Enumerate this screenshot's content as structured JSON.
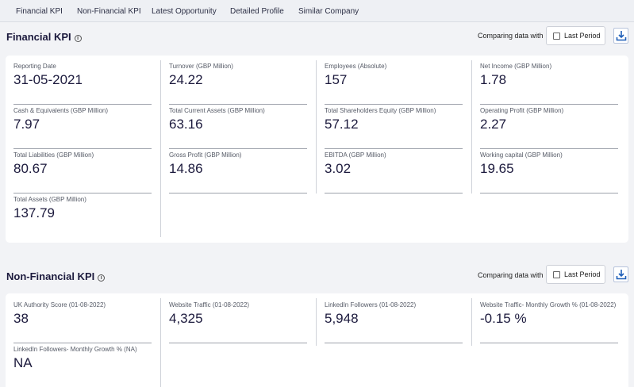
{
  "tabs": [
    "Financial KPI",
    "Non-Financial KPI",
    "Latest Opportunity",
    "Detailed Profile",
    "Similar Company"
  ],
  "financial": {
    "title": "Financial KPI",
    "info_glyph": "i",
    "comparing_label": "Comparing data with",
    "period_label": "Last Period",
    "kpis": [
      {
        "label": "Reporting Date",
        "value": "31-05-2021"
      },
      {
        "label": "Turnover (GBP Million)",
        "value": "24.22"
      },
      {
        "label": "Employees (Absolute)",
        "value": "157"
      },
      {
        "label": "Net Income (GBP Million)",
        "value": "1.78"
      },
      {
        "label": "Cash & Equivalents (GBP Million)",
        "value": "7.97"
      },
      {
        "label": "Total Current Assets (GBP Million)",
        "value": "63.16"
      },
      {
        "label": "Total Shareholders Equity (GBP Million)",
        "value": "57.12"
      },
      {
        "label": "Operating Profit (GBP Million)",
        "value": "2.27"
      },
      {
        "label": "Total Liabilities (GBP Million)",
        "value": "80.67"
      },
      {
        "label": "Gross Profit (GBP Million)",
        "value": "14.86"
      },
      {
        "label": "EBITDA (GBP Million)",
        "value": "3.02"
      },
      {
        "label": "Working capital (GBP Million)",
        "value": "19.65"
      },
      {
        "label": "Total Assets (GBP Million)",
        "value": "137.79"
      }
    ]
  },
  "nonfinancial": {
    "title": "Non-Financial KPI",
    "info_glyph": "i",
    "comparing_label": "Comparing data with",
    "period_label": "Last Period",
    "kpis": [
      {
        "label": "UK Authority Score (01-08-2022)",
        "value": "38"
      },
      {
        "label": "Website Traffic (01-08-2022)",
        "value": "4,325"
      },
      {
        "label": "LinkedIn Followers (01-08-2022)",
        "value": "5,948"
      },
      {
        "label": "Website Traffic- Monthly Growth % (01-08-2022)",
        "value": "-0.15 %"
      },
      {
        "label": "LinkedIn Followers- Monthly Growth % (NA)",
        "value": "NA"
      }
    ]
  },
  "colors": {
    "accent": "#1f5fb8",
    "text": "#1c1a3d"
  },
  "icons": {
    "download": "download-icon",
    "info": "info-icon",
    "checkbox": "checkbox-icon"
  }
}
